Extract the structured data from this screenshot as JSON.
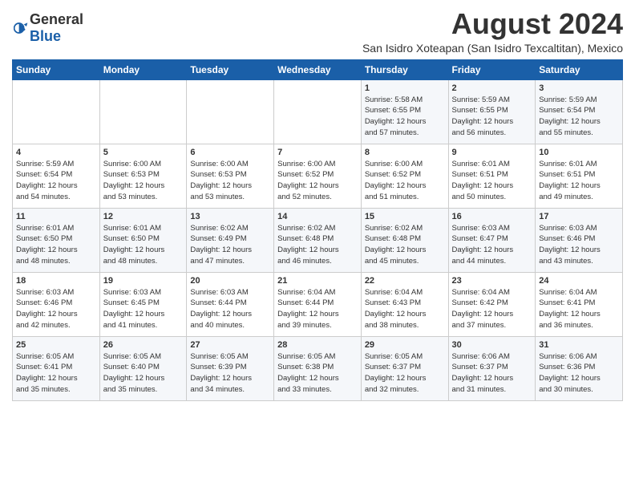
{
  "logo": {
    "text_general": "General",
    "text_blue": "Blue"
  },
  "title": "August 2024",
  "subtitle": "San Isidro Xoteapan (San Isidro Texcaltitan), Mexico",
  "days_of_week": [
    "Sunday",
    "Monday",
    "Tuesday",
    "Wednesday",
    "Thursday",
    "Friday",
    "Saturday"
  ],
  "weeks": [
    [
      {
        "day": "",
        "info": ""
      },
      {
        "day": "",
        "info": ""
      },
      {
        "day": "",
        "info": ""
      },
      {
        "day": "",
        "info": ""
      },
      {
        "day": "1",
        "info": "Sunrise: 5:58 AM\nSunset: 6:55 PM\nDaylight: 12 hours\nand 57 minutes."
      },
      {
        "day": "2",
        "info": "Sunrise: 5:59 AM\nSunset: 6:55 PM\nDaylight: 12 hours\nand 56 minutes."
      },
      {
        "day": "3",
        "info": "Sunrise: 5:59 AM\nSunset: 6:54 PM\nDaylight: 12 hours\nand 55 minutes."
      }
    ],
    [
      {
        "day": "4",
        "info": "Sunrise: 5:59 AM\nSunset: 6:54 PM\nDaylight: 12 hours\nand 54 minutes."
      },
      {
        "day": "5",
        "info": "Sunrise: 6:00 AM\nSunset: 6:53 PM\nDaylight: 12 hours\nand 53 minutes."
      },
      {
        "day": "6",
        "info": "Sunrise: 6:00 AM\nSunset: 6:53 PM\nDaylight: 12 hours\nand 53 minutes."
      },
      {
        "day": "7",
        "info": "Sunrise: 6:00 AM\nSunset: 6:52 PM\nDaylight: 12 hours\nand 52 minutes."
      },
      {
        "day": "8",
        "info": "Sunrise: 6:00 AM\nSunset: 6:52 PM\nDaylight: 12 hours\nand 51 minutes."
      },
      {
        "day": "9",
        "info": "Sunrise: 6:01 AM\nSunset: 6:51 PM\nDaylight: 12 hours\nand 50 minutes."
      },
      {
        "day": "10",
        "info": "Sunrise: 6:01 AM\nSunset: 6:51 PM\nDaylight: 12 hours\nand 49 minutes."
      }
    ],
    [
      {
        "day": "11",
        "info": "Sunrise: 6:01 AM\nSunset: 6:50 PM\nDaylight: 12 hours\nand 48 minutes."
      },
      {
        "day": "12",
        "info": "Sunrise: 6:01 AM\nSunset: 6:50 PM\nDaylight: 12 hours\nand 48 minutes."
      },
      {
        "day": "13",
        "info": "Sunrise: 6:02 AM\nSunset: 6:49 PM\nDaylight: 12 hours\nand 47 minutes."
      },
      {
        "day": "14",
        "info": "Sunrise: 6:02 AM\nSunset: 6:48 PM\nDaylight: 12 hours\nand 46 minutes."
      },
      {
        "day": "15",
        "info": "Sunrise: 6:02 AM\nSunset: 6:48 PM\nDaylight: 12 hours\nand 45 minutes."
      },
      {
        "day": "16",
        "info": "Sunrise: 6:03 AM\nSunset: 6:47 PM\nDaylight: 12 hours\nand 44 minutes."
      },
      {
        "day": "17",
        "info": "Sunrise: 6:03 AM\nSunset: 6:46 PM\nDaylight: 12 hours\nand 43 minutes."
      }
    ],
    [
      {
        "day": "18",
        "info": "Sunrise: 6:03 AM\nSunset: 6:46 PM\nDaylight: 12 hours\nand 42 minutes."
      },
      {
        "day": "19",
        "info": "Sunrise: 6:03 AM\nSunset: 6:45 PM\nDaylight: 12 hours\nand 41 minutes."
      },
      {
        "day": "20",
        "info": "Sunrise: 6:03 AM\nSunset: 6:44 PM\nDaylight: 12 hours\nand 40 minutes."
      },
      {
        "day": "21",
        "info": "Sunrise: 6:04 AM\nSunset: 6:44 PM\nDaylight: 12 hours\nand 39 minutes."
      },
      {
        "day": "22",
        "info": "Sunrise: 6:04 AM\nSunset: 6:43 PM\nDaylight: 12 hours\nand 38 minutes."
      },
      {
        "day": "23",
        "info": "Sunrise: 6:04 AM\nSunset: 6:42 PM\nDaylight: 12 hours\nand 37 minutes."
      },
      {
        "day": "24",
        "info": "Sunrise: 6:04 AM\nSunset: 6:41 PM\nDaylight: 12 hours\nand 36 minutes."
      }
    ],
    [
      {
        "day": "25",
        "info": "Sunrise: 6:05 AM\nSunset: 6:41 PM\nDaylight: 12 hours\nand 35 minutes."
      },
      {
        "day": "26",
        "info": "Sunrise: 6:05 AM\nSunset: 6:40 PM\nDaylight: 12 hours\nand 35 minutes."
      },
      {
        "day": "27",
        "info": "Sunrise: 6:05 AM\nSunset: 6:39 PM\nDaylight: 12 hours\nand 34 minutes."
      },
      {
        "day": "28",
        "info": "Sunrise: 6:05 AM\nSunset: 6:38 PM\nDaylight: 12 hours\nand 33 minutes."
      },
      {
        "day": "29",
        "info": "Sunrise: 6:05 AM\nSunset: 6:37 PM\nDaylight: 12 hours\nand 32 minutes."
      },
      {
        "day": "30",
        "info": "Sunrise: 6:06 AM\nSunset: 6:37 PM\nDaylight: 12 hours\nand 31 minutes."
      },
      {
        "day": "31",
        "info": "Sunrise: 6:06 AM\nSunset: 6:36 PM\nDaylight: 12 hours\nand 30 minutes."
      }
    ]
  ]
}
